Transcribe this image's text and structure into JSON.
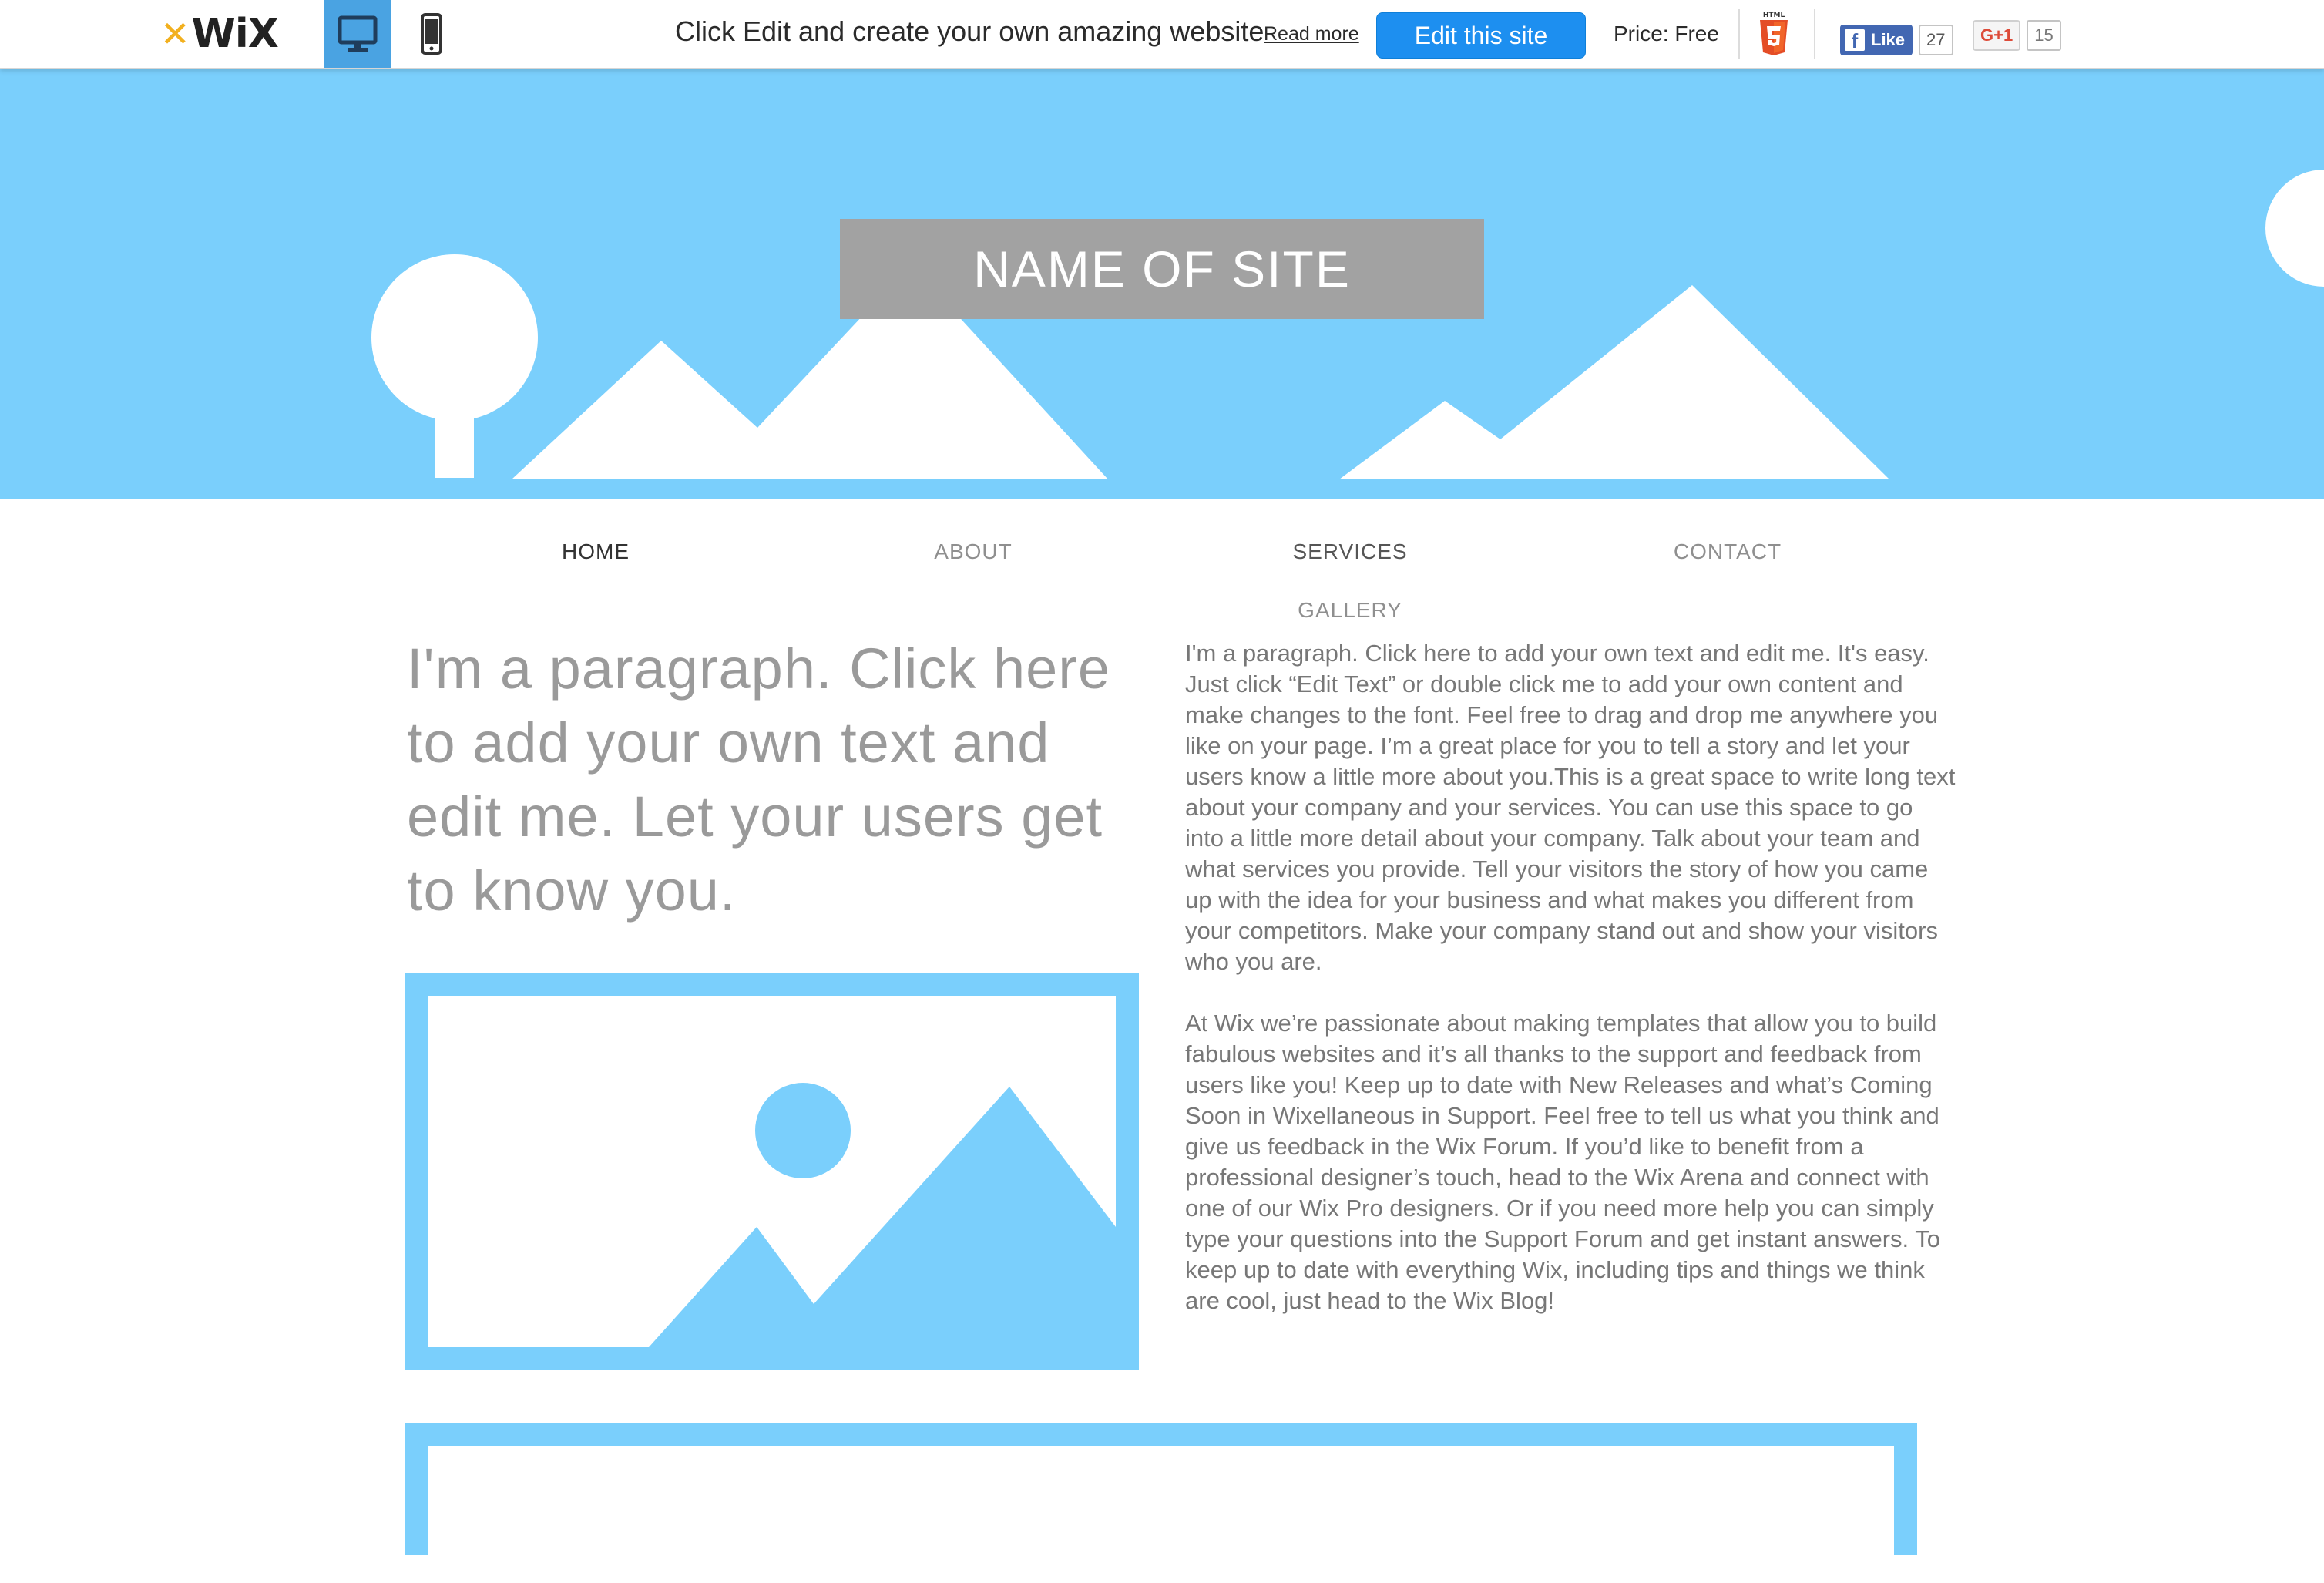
{
  "topbar": {
    "logo_text": "WiX",
    "tagline": "Click Edit and create your own amazing website",
    "read_more": "Read more",
    "edit_button": "Edit this site",
    "price": "Price: Free",
    "html5_badge": "HTML",
    "fb_like_label": "Like",
    "fb_like_count": "27",
    "gplus_label": "G+1",
    "gplus_count": "15"
  },
  "header": {
    "site_name": "NAME OF SITE"
  },
  "nav": {
    "items": [
      "HOME",
      "ABOUT",
      "SERVICES",
      "CONTACT",
      "GALLERY"
    ]
  },
  "content": {
    "big_paragraph": "I'm a paragraph. Click here to add your own text and edit me. Let your users get to know you.",
    "paragraph_1": "I'm a paragraph. Click here to add your own text and edit me. It's easy. Just click “Edit Text” or double click me to add your own content and make changes to the font. Feel free to drag and drop me anywhere you like on your page. I’m a great place for you to tell a story and let your users know a little more about you.This is a great space to write long text about your company and your services. You can use this space to go into a little more detail about your company. Talk about your team and what services you provide. Tell your visitors the story of how you came up with the idea for your business and what makes you different from your competitors. Make your company stand out and show your visitors who you are.",
    "paragraph_2": "At Wix we’re passionate about making templates that allow you to build fabulous websites and it’s all thanks to the support and feedback from users like you! Keep up to date with New Releases and what’s Coming Soon in Wixellaneous in Support. Feel free to tell us what you think and give us feedback in the Wix Forum. If you’d like to benefit from a professional designer’s touch, head to the Wix Arena and connect with one of our Wix Pro designers. Or if you need more help you can simply type your questions into the Support Forum and get instant answers. To keep up to date with everything Wix, including tips and things we think are cool, just head to the Wix Blog!"
  },
  "colors": {
    "accent_blue": "#7acffc",
    "button_blue": "#1d8ff0",
    "site_name_bg": "#a2a2a2"
  }
}
